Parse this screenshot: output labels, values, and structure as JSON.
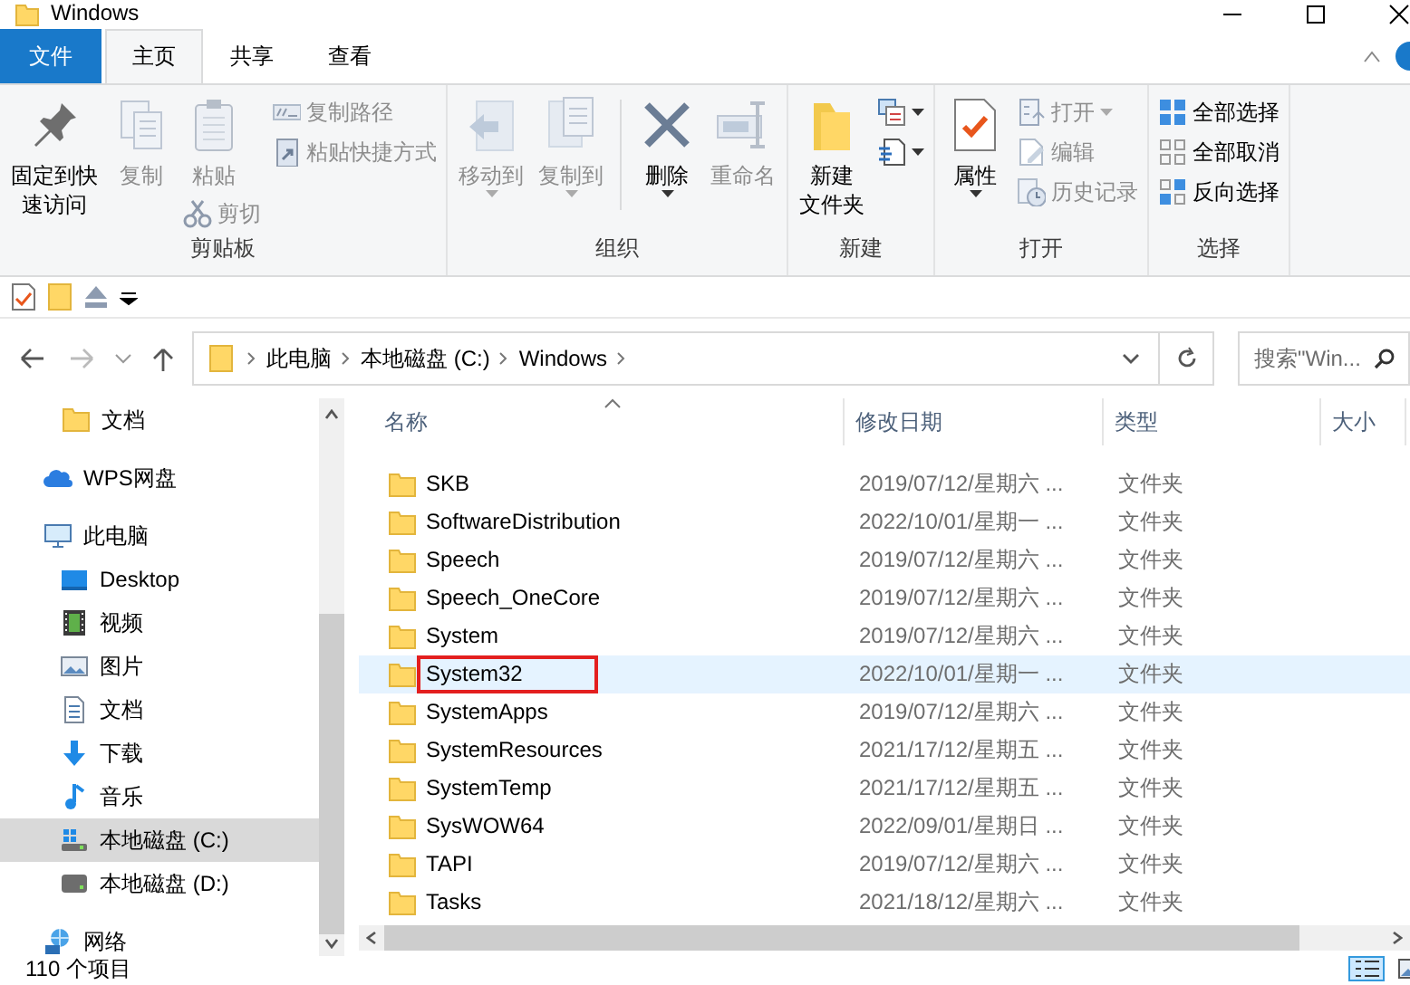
{
  "window": {
    "title": "Windows"
  },
  "ribbon_tabs": [
    {
      "label": "文件",
      "kind": "file",
      "selected": false
    },
    {
      "label": "主页",
      "kind": "tab",
      "selected": true
    },
    {
      "label": "共享",
      "kind": "tab",
      "selected": false
    },
    {
      "label": "查看",
      "kind": "tab",
      "selected": false
    }
  ],
  "ribbon_groups": [
    {
      "title": "剪贴板",
      "columns": [
        {
          "controls": [
            {
              "kind": "large",
              "lines": [
                "固定到快",
                "速访问"
              ],
              "disabled": false,
              "dropdown": false
            }
          ]
        },
        {
          "controls": [
            {
              "kind": "large",
              "lines": [
                "复制"
              ],
              "disabled": true,
              "dropdown": false
            }
          ]
        },
        {
          "controls": [
            {
              "kind": "large",
              "lines": [
                "粘贴"
              ],
              "disabled": true,
              "dropdown": false
            },
            {
              "kind": "small",
              "label": "剪切",
              "disabled": true,
              "dropdown": false
            }
          ]
        },
        {
          "controls": [
            {
              "kind": "small",
              "label": "复制路径",
              "disabled": true,
              "dropdown": false
            },
            {
              "kind": "small",
              "label": "粘贴快捷方式",
              "disabled": true,
              "dropdown": false
            }
          ]
        }
      ]
    },
    {
      "title": "组织",
      "columns": [
        {
          "controls": [
            {
              "kind": "large",
              "lines": [
                "移动到"
              ],
              "disabled": true,
              "dropdown": true
            }
          ]
        },
        {
          "controls": [
            {
              "kind": "large",
              "lines": [
                "复制到"
              ],
              "disabled": true,
              "dropdown": true
            }
          ]
        },
        {
          "controls": [
            {
              "kind": "large",
              "lines": [
                "删除"
              ],
              "disabled": false,
              "dropdown": true
            }
          ]
        },
        {
          "controls": [
            {
              "kind": "large",
              "lines": [
                "重命名"
              ],
              "disabled": true,
              "dropdown": false
            }
          ]
        }
      ]
    },
    {
      "title": "新建",
      "columns": [
        {
          "controls": [
            {
              "kind": "large",
              "lines": [
                "新建",
                "文件夹"
              ],
              "disabled": false,
              "dropdown": false
            }
          ]
        },
        {
          "controls": [
            {
              "kind": "icon",
              "disabled": false,
              "dropdown": true
            },
            {
              "kind": "icon",
              "disabled": false,
              "dropdown": true
            }
          ]
        }
      ]
    },
    {
      "title": "打开",
      "columns": [
        {
          "controls": [
            {
              "kind": "large",
              "lines": [
                "属性"
              ],
              "disabled": false,
              "dropdown": true
            }
          ]
        },
        {
          "controls": [
            {
              "kind": "small",
              "label": "打开",
              "disabled": true,
              "dropdown": true
            },
            {
              "kind": "small",
              "label": "编辑",
              "disabled": true,
              "dropdown": false
            },
            {
              "kind": "small",
              "label": "历史记录",
              "disabled": true,
              "dropdown": false
            }
          ]
        }
      ]
    },
    {
      "title": "选择",
      "columns": [
        {
          "controls": [
            {
              "kind": "small",
              "label": "全部选择",
              "disabled": false,
              "dropdown": false
            },
            {
              "kind": "small",
              "label": "全部取消",
              "disabled": false,
              "dropdown": false
            },
            {
              "kind": "small",
              "label": "反向选择",
              "disabled": false,
              "dropdown": false
            }
          ]
        }
      ]
    }
  ],
  "address_bar": {
    "segments": [
      "此电脑",
      "本地磁盘 (C:)",
      "Windows"
    ]
  },
  "search": {
    "placeholder": "搜索\"Win..."
  },
  "sidebar": {
    "quick_access_items": [
      {
        "label": "文档",
        "selected": false
      }
    ],
    "items": [
      {
        "label": "WPS网盘",
        "selected": false
      },
      {
        "label": "此电脑",
        "selected": false,
        "children": [
          {
            "label": "Desktop",
            "selected": false
          },
          {
            "label": "视频",
            "selected": false
          },
          {
            "label": "图片",
            "selected": false
          },
          {
            "label": "文档",
            "selected": false
          },
          {
            "label": "下载",
            "selected": false
          },
          {
            "label": "音乐",
            "selected": false
          },
          {
            "label": "本地磁盘 (C:)",
            "selected": true
          },
          {
            "label": "本地磁盘 (D:)",
            "selected": false
          }
        ]
      },
      {
        "label": "网络",
        "selected": false
      }
    ]
  },
  "file_list": {
    "columns": [
      "名称",
      "修改日期",
      "类型",
      "大小"
    ],
    "rows": [
      {
        "name": "SKB",
        "modified": "2019/07/12/星期六 ...",
        "type": "文件夹",
        "selected": false,
        "annotated": false
      },
      {
        "name": "SoftwareDistribution",
        "modified": "2022/10/01/星期一 ...",
        "type": "文件夹",
        "selected": false,
        "annotated": false
      },
      {
        "name": "Speech",
        "modified": "2019/07/12/星期六 ...",
        "type": "文件夹",
        "selected": false,
        "annotated": false
      },
      {
        "name": "Speech_OneCore",
        "modified": "2019/07/12/星期六 ...",
        "type": "文件夹",
        "selected": false,
        "annotated": false
      },
      {
        "name": "System",
        "modified": "2019/07/12/星期六 ...",
        "type": "文件夹",
        "selected": false,
        "annotated": false
      },
      {
        "name": "System32",
        "modified": "2022/10/01/星期一 ...",
        "type": "文件夹",
        "selected": true,
        "annotated": true
      },
      {
        "name": "SystemApps",
        "modified": "2019/07/12/星期六 ...",
        "type": "文件夹",
        "selected": false,
        "annotated": false
      },
      {
        "name": "SystemResources",
        "modified": "2021/17/12/星期五 ...",
        "type": "文件夹",
        "selected": false,
        "annotated": false
      },
      {
        "name": "SystemTemp",
        "modified": "2021/17/12/星期五 ...",
        "type": "文件夹",
        "selected": false,
        "annotated": false
      },
      {
        "name": "SysWOW64",
        "modified": "2022/09/01/星期日 ...",
        "type": "文件夹",
        "selected": false,
        "annotated": false
      },
      {
        "name": "TAPI",
        "modified": "2019/07/12/星期六 ...",
        "type": "文件夹",
        "selected": false,
        "annotated": false
      },
      {
        "name": "Tasks",
        "modified": "2021/18/12/星期六 ...",
        "type": "文件夹",
        "selected": false,
        "annotated": false
      }
    ]
  },
  "view_buttons": [
    {
      "kind": "details",
      "selected": true
    },
    {
      "kind": "large_icons",
      "selected": false
    }
  ],
  "status_bar": {
    "item_count": "110 个项目"
  }
}
